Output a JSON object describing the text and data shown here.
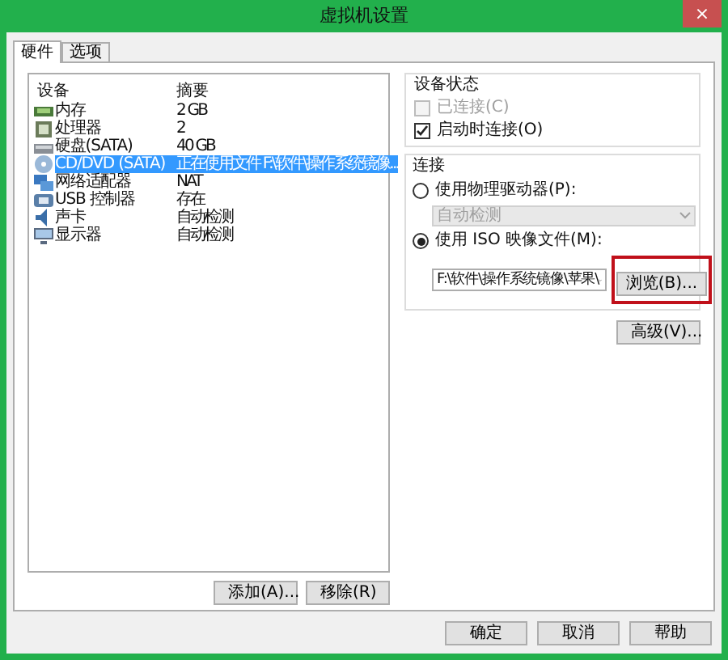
{
  "window": {
    "title": "虚拟机设置",
    "close": "×"
  },
  "tabs": [
    {
      "label": "硬件",
      "selected": true
    },
    {
      "label": "选项",
      "selected": false
    }
  ],
  "devices": {
    "columns": [
      "设备",
      "摘要"
    ],
    "rows": [
      {
        "kind": "memory",
        "name": "内存",
        "summary": "2 GB",
        "selected": false
      },
      {
        "kind": "cpu",
        "name": "处理器",
        "summary": "2",
        "selected": false
      },
      {
        "kind": "disk",
        "name": "硬盘(SATA)",
        "summary": "40 GB",
        "selected": false
      },
      {
        "kind": "cdrom",
        "name": "CD/DVD (SATA)",
        "summary": "正在使用文件 F:\\软件\\操作系统镜像...",
        "selected": true
      },
      {
        "kind": "network",
        "name": "网络适配器",
        "summary": "NAT",
        "selected": false
      },
      {
        "kind": "usb",
        "name": "USB 控制器",
        "summary": "存在",
        "selected": false
      },
      {
        "kind": "sound",
        "name": "声卡",
        "summary": "自动检测",
        "selected": false
      },
      {
        "kind": "display",
        "name": "显示器",
        "summary": "自动检测",
        "selected": false
      }
    ]
  },
  "list_buttons": [
    "添加(A)...",
    "移除(R)"
  ],
  "device_status": {
    "title": "设备状态",
    "options": [
      {
        "label": "已连接(C)",
        "checked": false,
        "disabled": true
      },
      {
        "label": "启动时连接(O)",
        "checked": true,
        "disabled": false
      }
    ]
  },
  "connection": {
    "title": "连接",
    "physical": {
      "label": "使用物理驱动器(P):",
      "selected": false,
      "drive": "自动检测"
    },
    "iso": {
      "label": "使用 ISO 映像文件(M):",
      "selected": true,
      "path": "F:\\软件\\操作系统镜像\\苹果\\"
    },
    "browse": {
      "label": "浏览(B)...",
      "highlighted": true
    }
  },
  "advanced": "高级(V)...",
  "dialog_buttons": [
    "确定",
    "取消",
    "帮助"
  ]
}
